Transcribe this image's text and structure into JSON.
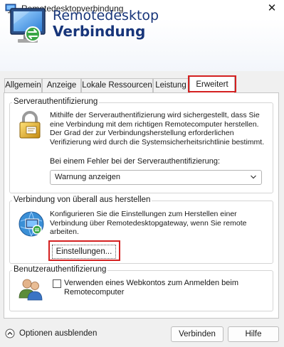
{
  "window": {
    "title": "Remotedesktopverbindung",
    "close_glyph": "✕"
  },
  "banner": {
    "line1": "Remotedesktop",
    "line2": "Verbindung"
  },
  "tabs": [
    {
      "label": "Allgemein",
      "active": false
    },
    {
      "label": "Anzeige",
      "active": false
    },
    {
      "label": "Lokale Ressourcen",
      "active": false
    },
    {
      "label": "Leistung",
      "active": false
    },
    {
      "label": "Erweitert",
      "active": true
    }
  ],
  "server_auth": {
    "heading": "Serverauthentifizierung",
    "description": "Mithilfe der Serverauthentifizierung wird sichergestellt, dass Sie eine Verbindung mit dem richtigen Remotecomputer herstellen. Der Grad der zur Verbindungsherstellung erforderlichen Verifizierung wird durch die Systemsicherheitsrichtlinie bestimmt.",
    "prompt": "Bei einem Fehler bei der Serverauthentifizierung:",
    "selected_option": "Warnung anzeigen",
    "icon": "lock-icon"
  },
  "connect_anywhere": {
    "heading": "Verbindung von überall aus herstellen",
    "description": "Konfigurieren Sie die Einstellungen zum Herstellen einer Verbindung über Remotedesktopgateway, wenn Sie remote arbeiten.",
    "settings_button": "Einstellungen...",
    "icon": "network-computer-icon"
  },
  "user_auth": {
    "heading": "Benutzerauthentifizierung",
    "checkbox_label": "Verwenden eines Webkontos zum Anmelden beim Remotecomputer",
    "checkbox_checked": false,
    "icon": "users-icon"
  },
  "footer": {
    "options_label": "Optionen ausblenden",
    "connect_button": "Verbinden",
    "help_button": "Hilfe"
  },
  "colors": {
    "banner_text": "#17357a",
    "highlight": "#d42020",
    "dialog_bg": "#f0f0f0"
  }
}
